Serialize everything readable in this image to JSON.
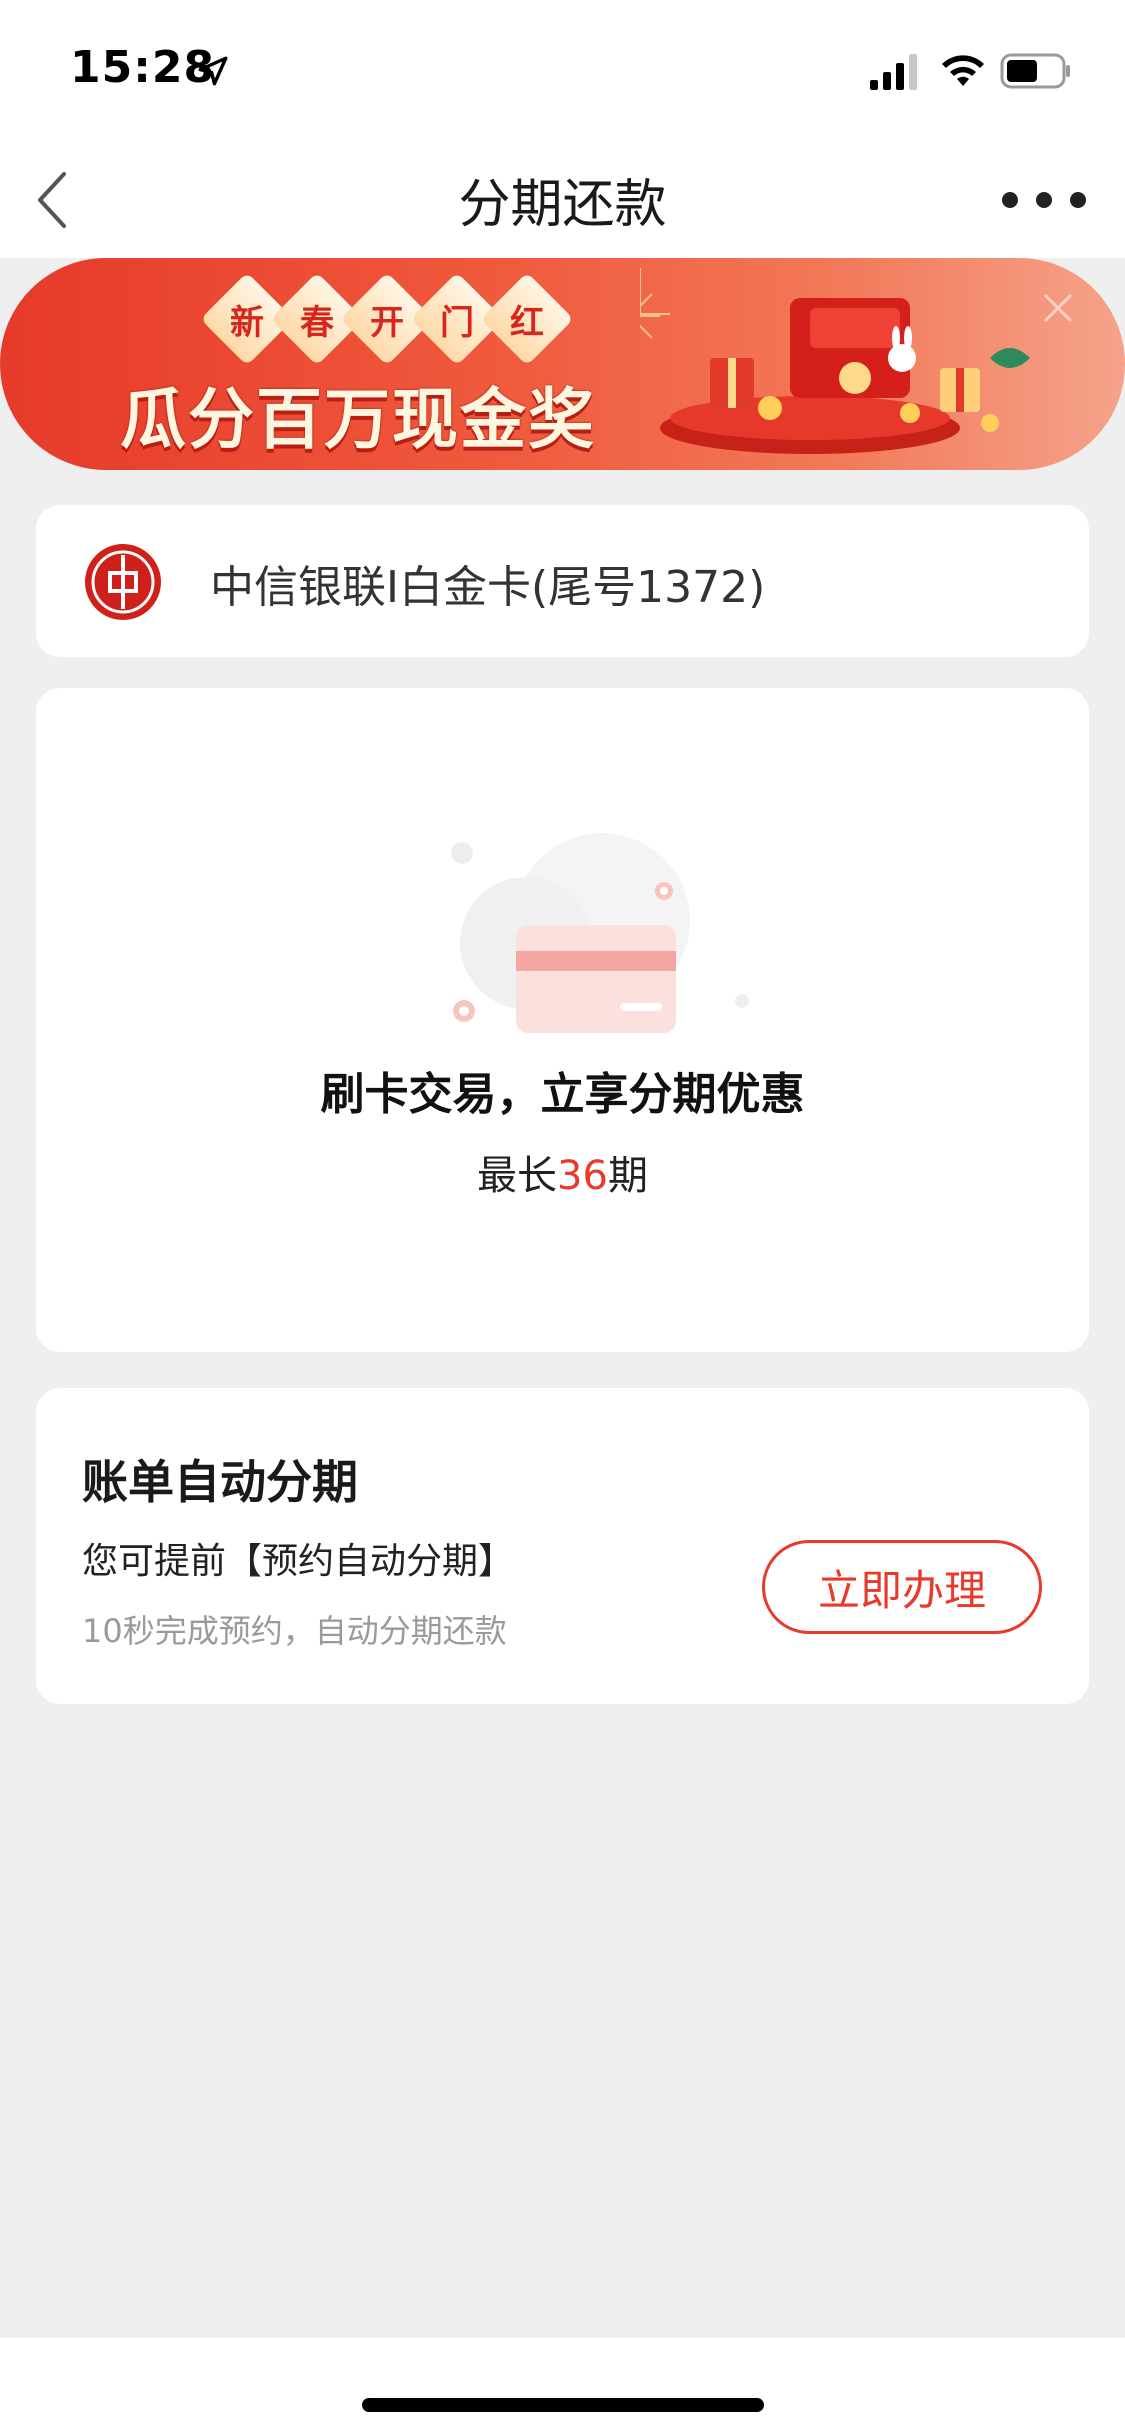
{
  "status_bar": {
    "time": "15:28",
    "icons": [
      "location-arrow-icon",
      "cellular-signal-icon",
      "wifi-icon",
      "battery-icon"
    ]
  },
  "nav": {
    "title": "分期还款",
    "back_icon": "chevron-left-icon",
    "more_icon": "more-dots-icon"
  },
  "banner": {
    "top_chars": [
      "新",
      "春",
      "开",
      "门",
      "红"
    ],
    "headline": "瓜分百万现金奖池",
    "close_icon": "close-icon",
    "colors": {
      "start": "#e63a2a",
      "end": "#f5a38a"
    }
  },
  "card_selector": {
    "bank_logo": "citic-bank-logo",
    "label": "中信银联I白金卡(尾号1372)"
  },
  "empty_state": {
    "illustration": "credit-card-illustration",
    "title": "刷卡交易，立享分期优惠",
    "sub_prefix": "最长",
    "sub_highlight": "36",
    "sub_suffix": "期"
  },
  "auto_installment": {
    "title": "账单自动分期",
    "line1": "您可提前【预约自动分期】",
    "line2": "10秒完成预约，自动分期还款",
    "button_label": "立即办理"
  },
  "colors": {
    "accent": "#e8392b",
    "page_bg": "#efefef",
    "card_bg": "#ffffff"
  }
}
